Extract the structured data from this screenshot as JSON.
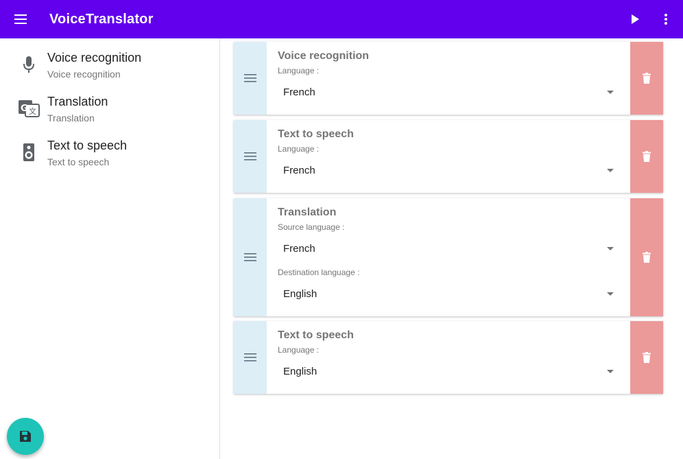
{
  "appbar": {
    "title": "VoiceTranslator",
    "icons": {
      "menu": "menu-icon",
      "play": "play-icon",
      "more": "more-vert-icon"
    }
  },
  "sidebar": {
    "items": [
      {
        "title": "Voice recognition",
        "subtitle": "Voice recognition",
        "icon": "microphone-icon"
      },
      {
        "title": "Translation",
        "subtitle": "Translation",
        "icon": "translate-icon"
      },
      {
        "title": "Text to speech",
        "subtitle": "Text to speech",
        "icon": "speaker-icon"
      }
    ]
  },
  "fab": {
    "icon": "save-icon"
  },
  "cards": [
    {
      "title": "Voice recognition",
      "label": "Language :",
      "value": "French"
    },
    {
      "title": "Text to speech",
      "label": "Language :",
      "value": "French"
    },
    {
      "title": "Translation",
      "source_label": "Source language :",
      "source_value": "French",
      "dest_label": "Destination language :",
      "dest_value": "English"
    },
    {
      "title": "Text to speech",
      "label": "Language :",
      "value": "English"
    }
  ],
  "colors": {
    "appbar": "#6200ee",
    "handle": "#ddeef7",
    "delete": "#ec9999",
    "fab": "#1dc4b7"
  }
}
